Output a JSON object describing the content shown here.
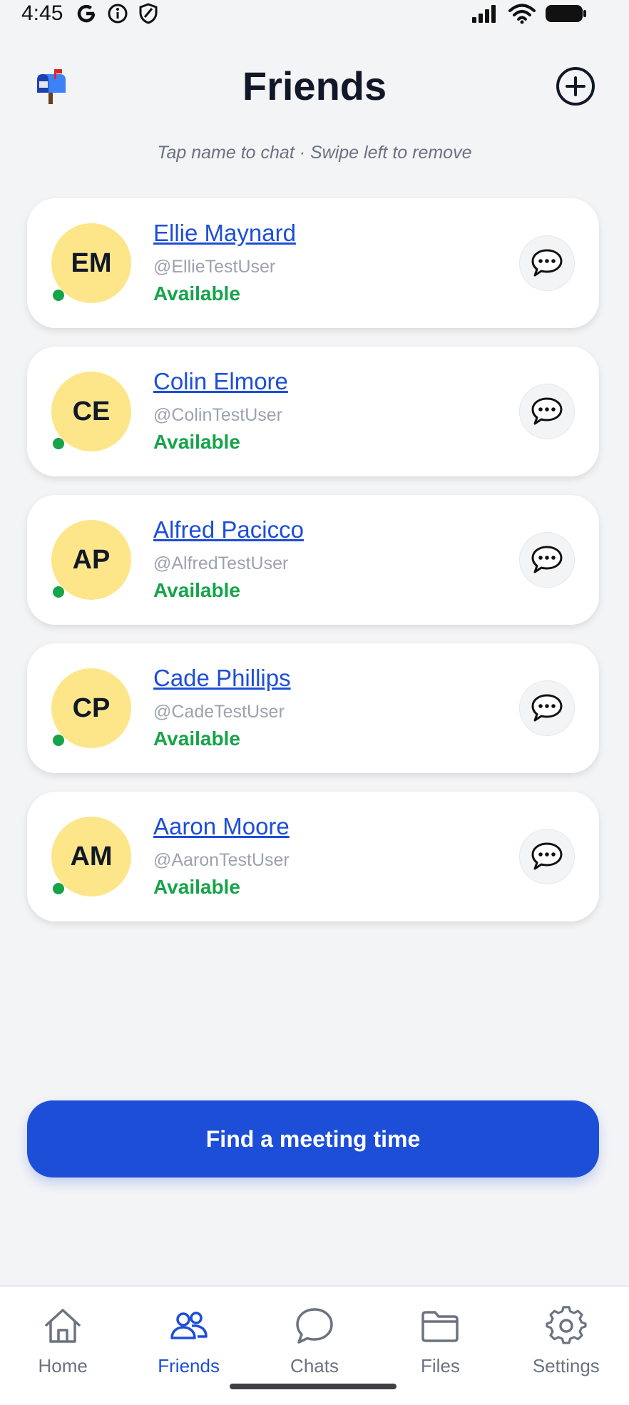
{
  "status_bar": {
    "time": "4:45"
  },
  "header": {
    "title": "Friends"
  },
  "subtitle": "Tap name to chat · Swipe left to remove",
  "friends": [
    {
      "initials": "EM",
      "name": "Ellie Maynard",
      "handle": "@EllieTestUser",
      "status": "Available"
    },
    {
      "initials": "CE",
      "name": "Colin Elmore",
      "handle": "@ColinTestUser",
      "status": "Available"
    },
    {
      "initials": "AP",
      "name": "Alfred Pacicco",
      "handle": "@AlfredTestUser",
      "status": "Available"
    },
    {
      "initials": "CP",
      "name": "Cade Phillips",
      "handle": "@CadeTestUser",
      "status": "Available"
    },
    {
      "initials": "AM",
      "name": "Aaron Moore",
      "handle": "@AaronTestUser",
      "status": "Available"
    }
  ],
  "cta": {
    "label": "Find a meeting time"
  },
  "nav": [
    {
      "label": "Home",
      "icon": "home-icon"
    },
    {
      "label": "Friends",
      "icon": "friends-icon",
      "active": true
    },
    {
      "label": "Chats",
      "icon": "chat-bubble-icon"
    },
    {
      "label": "Files",
      "icon": "folder-icon"
    },
    {
      "label": "Settings",
      "icon": "gear-icon"
    }
  ],
  "colors": {
    "accent": "#1d4ed8",
    "available": "#16a34a",
    "avatar_bg": "#fde68a",
    "background": "#f3f4f6"
  }
}
